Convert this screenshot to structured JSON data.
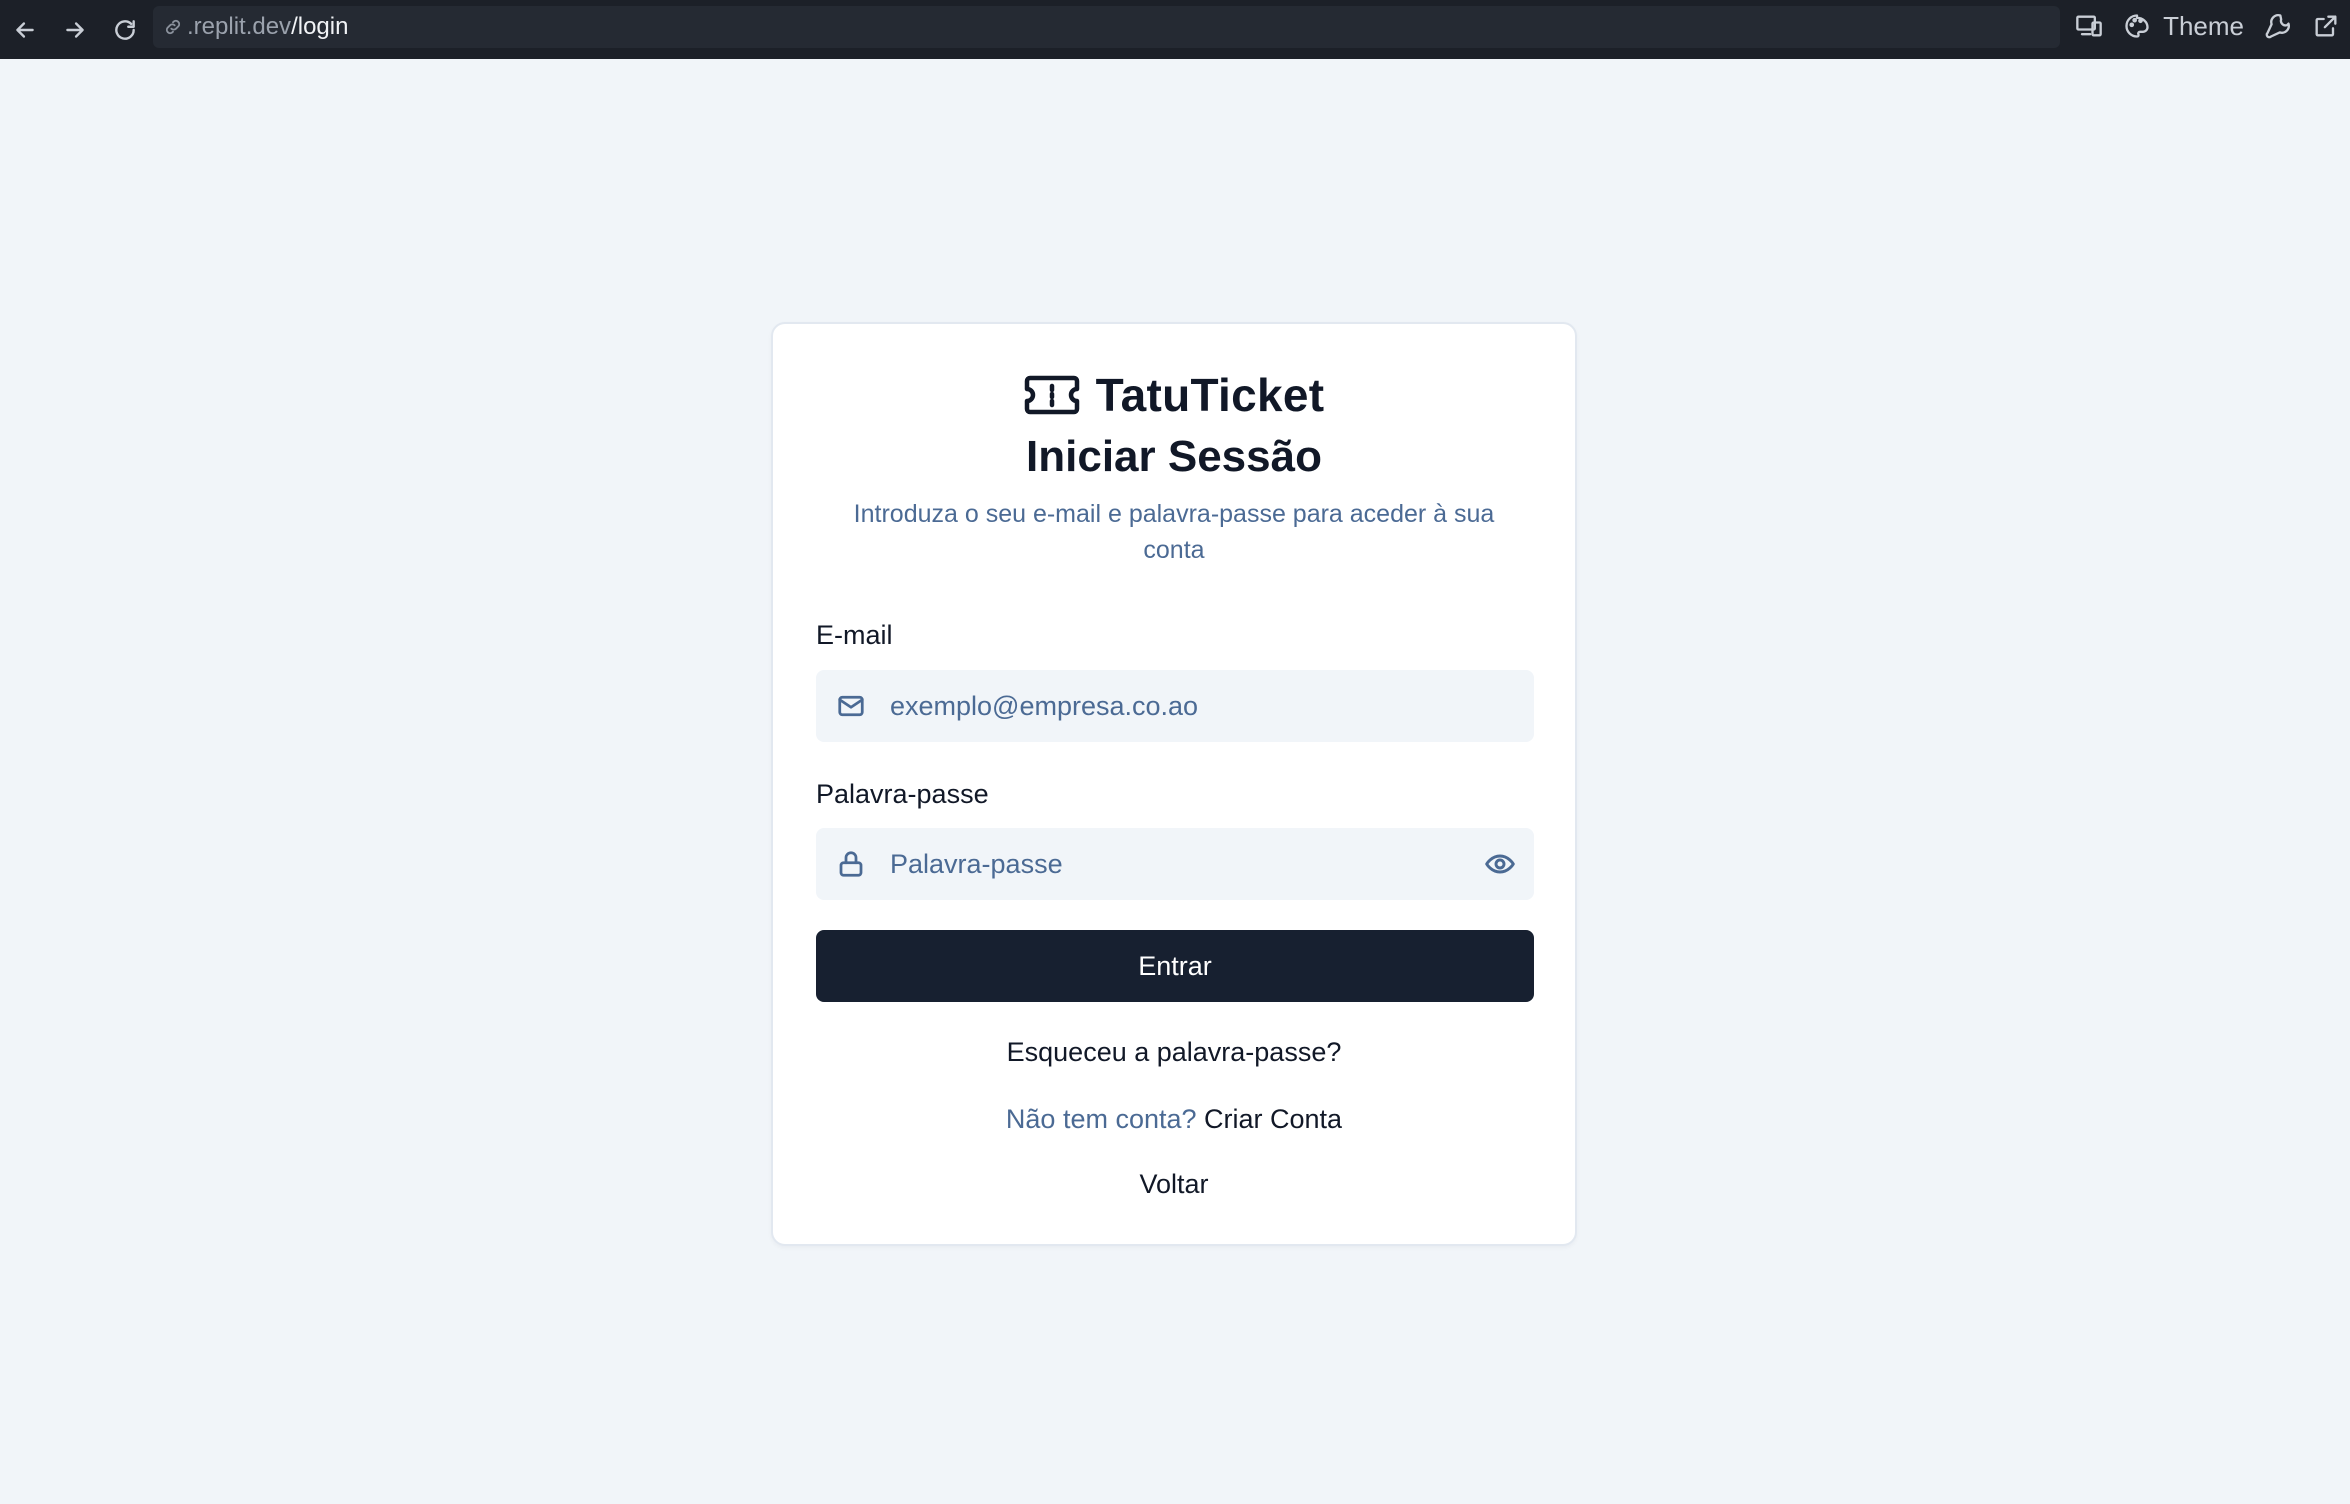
{
  "browser": {
    "url_host": ".replit.dev",
    "url_path": "/login",
    "theme_label": "Theme",
    "icons": [
      "back-arrow-icon",
      "forward-arrow-icon",
      "reload-icon",
      "link-icon",
      "devices-icon",
      "palette-icon",
      "wrench-icon",
      "external-link-icon"
    ]
  },
  "card": {
    "brand_name": "TatuTicket",
    "brand_icon": "ticket-icon",
    "title": "Iniciar Sessão",
    "subtitle": "Introduza o seu e-mail e palavra-passe para aceder à sua conta"
  },
  "form": {
    "email_label": "E-mail",
    "email_placeholder": "exemplo@empresa.co.ao",
    "email_icon": "mail-icon",
    "password_label": "Palavra-passe",
    "password_placeholder": "Palavra-passe",
    "password_icon": "lock-icon",
    "toggle_icon": "eye-icon",
    "submit_label": "Entrar"
  },
  "links": {
    "forgot_password": "Esqueceu a palavra-passe?",
    "no_account_text": "Não tem conta?",
    "create_account": "Criar Conta",
    "back": "Voltar"
  },
  "colors": {
    "page_bg": "#f1f5f9",
    "topbar_bg": "#1c2028",
    "primary_button": "#172030",
    "muted_text": "#4b6a94"
  }
}
